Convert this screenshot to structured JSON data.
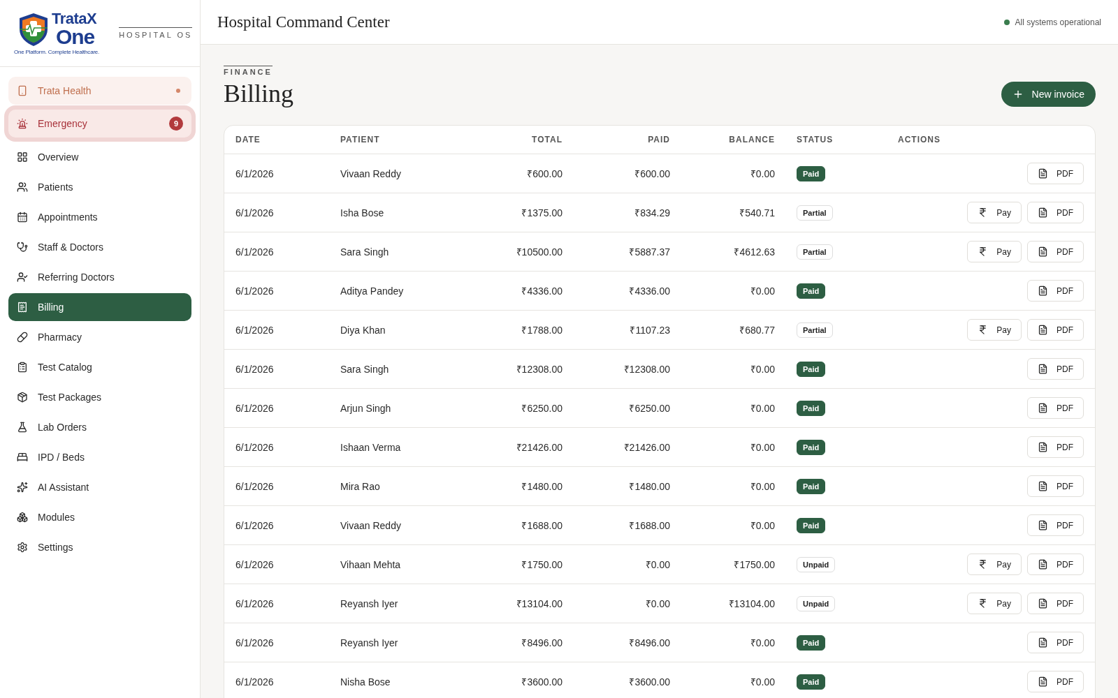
{
  "brand": {
    "name_top": "TrataX",
    "name_bottom": "One",
    "tagline": "One Platform. Complete Healthcare.",
    "product": "HOSPITAL OS"
  },
  "sidebar": {
    "items": [
      {
        "label": "Trata Health",
        "kind": "brand",
        "selected": false,
        "dot": true
      },
      {
        "label": "Emergency",
        "kind": "alert",
        "selected": false,
        "badge": "9"
      },
      {
        "label": "Overview",
        "kind": "normal",
        "selected": false
      },
      {
        "label": "Patients",
        "kind": "normal",
        "selected": false
      },
      {
        "label": "Appointments",
        "kind": "normal",
        "selected": false
      },
      {
        "label": "Staff & Doctors",
        "kind": "normal",
        "selected": false
      },
      {
        "label": "Referring Doctors",
        "kind": "normal",
        "selected": false
      },
      {
        "label": "Billing",
        "kind": "normal",
        "selected": true
      },
      {
        "label": "Pharmacy",
        "kind": "normal",
        "selected": false
      },
      {
        "label": "Test Catalog",
        "kind": "normal",
        "selected": false
      },
      {
        "label": "Test Packages",
        "kind": "normal",
        "selected": false
      },
      {
        "label": "Lab Orders",
        "kind": "normal",
        "selected": false
      },
      {
        "label": "IPD / Beds",
        "kind": "normal",
        "selected": false
      },
      {
        "label": "AI Assistant",
        "kind": "normal",
        "selected": false
      },
      {
        "label": "Modules",
        "kind": "normal",
        "selected": false
      },
      {
        "label": "Settings",
        "kind": "normal",
        "selected": false
      }
    ]
  },
  "header": {
    "title": "Hospital Command Center",
    "status": "All systems operational"
  },
  "page": {
    "eyebrow": "FINANCE",
    "title": "Billing",
    "new_button": "New invoice"
  },
  "table": {
    "columns": [
      "DATE",
      "PATIENT",
      "TOTAL",
      "PAID",
      "BALANCE",
      "STATUS",
      "ACTIONS"
    ],
    "rows": [
      {
        "date": "6/1/2026",
        "patient": "Vivaan Reddy",
        "total": "₹600.00",
        "paid": "₹600.00",
        "balance": "₹0.00",
        "status": {
          "label": "Paid",
          "kind": "paid"
        },
        "actions": [
          {
            "kind": "pdf",
            "label": "PDF"
          }
        ]
      },
      {
        "date": "6/1/2026",
        "patient": "Isha Bose",
        "total": "₹1375.00",
        "paid": "₹834.29",
        "balance": "₹540.71",
        "status": {
          "label": "Partial",
          "kind": "partial"
        },
        "actions": [
          {
            "kind": "pay",
            "label": "Pay"
          },
          {
            "kind": "pdf",
            "label": "PDF"
          }
        ]
      },
      {
        "date": "6/1/2026",
        "patient": "Sara Singh",
        "total": "₹10500.00",
        "paid": "₹5887.37",
        "balance": "₹4612.63",
        "status": {
          "label": "Partial",
          "kind": "partial"
        },
        "actions": [
          {
            "kind": "pay",
            "label": "Pay"
          },
          {
            "kind": "pdf",
            "label": "PDF"
          }
        ]
      },
      {
        "date": "6/1/2026",
        "patient": "Aditya Pandey",
        "total": "₹4336.00",
        "paid": "₹4336.00",
        "balance": "₹0.00",
        "status": {
          "label": "Paid",
          "kind": "paid"
        },
        "actions": [
          {
            "kind": "pdf",
            "label": "PDF"
          }
        ]
      },
      {
        "date": "6/1/2026",
        "patient": "Diya Khan",
        "total": "₹1788.00",
        "paid": "₹1107.23",
        "balance": "₹680.77",
        "status": {
          "label": "Partial",
          "kind": "partial"
        },
        "actions": [
          {
            "kind": "pay",
            "label": "Pay"
          },
          {
            "kind": "pdf",
            "label": "PDF"
          }
        ]
      },
      {
        "date": "6/1/2026",
        "patient": "Sara Singh",
        "total": "₹12308.00",
        "paid": "₹12308.00",
        "balance": "₹0.00",
        "status": {
          "label": "Paid",
          "kind": "paid"
        },
        "actions": [
          {
            "kind": "pdf",
            "label": "PDF"
          }
        ]
      },
      {
        "date": "6/1/2026",
        "patient": "Arjun Singh",
        "total": "₹6250.00",
        "paid": "₹6250.00",
        "balance": "₹0.00",
        "status": {
          "label": "Paid",
          "kind": "paid"
        },
        "actions": [
          {
            "kind": "pdf",
            "label": "PDF"
          }
        ]
      },
      {
        "date": "6/1/2026",
        "patient": "Ishaan Verma",
        "total": "₹21426.00",
        "paid": "₹21426.00",
        "balance": "₹0.00",
        "status": {
          "label": "Paid",
          "kind": "paid"
        },
        "actions": [
          {
            "kind": "pdf",
            "label": "PDF"
          }
        ]
      },
      {
        "date": "6/1/2026",
        "patient": "Mira Rao",
        "total": "₹1480.00",
        "paid": "₹1480.00",
        "balance": "₹0.00",
        "status": {
          "label": "Paid",
          "kind": "paid"
        },
        "actions": [
          {
            "kind": "pdf",
            "label": "PDF"
          }
        ]
      },
      {
        "date": "6/1/2026",
        "patient": "Vivaan Reddy",
        "total": "₹1688.00",
        "paid": "₹1688.00",
        "balance": "₹0.00",
        "status": {
          "label": "Paid",
          "kind": "paid"
        },
        "actions": [
          {
            "kind": "pdf",
            "label": "PDF"
          }
        ]
      },
      {
        "date": "6/1/2026",
        "patient": "Vihaan Mehta",
        "total": "₹1750.00",
        "paid": "₹0.00",
        "balance": "₹1750.00",
        "status": {
          "label": "Unpaid",
          "kind": "unpaid"
        },
        "actions": [
          {
            "kind": "pay",
            "label": "Pay"
          },
          {
            "kind": "pdf",
            "label": "PDF"
          }
        ]
      },
      {
        "date": "6/1/2026",
        "patient": "Reyansh Iyer",
        "total": "₹13104.00",
        "paid": "₹0.00",
        "balance": "₹13104.00",
        "status": {
          "label": "Unpaid",
          "kind": "unpaid"
        },
        "actions": [
          {
            "kind": "pay",
            "label": "Pay"
          },
          {
            "kind": "pdf",
            "label": "PDF"
          }
        ]
      },
      {
        "date": "6/1/2026",
        "patient": "Reyansh Iyer",
        "total": "₹8496.00",
        "paid": "₹8496.00",
        "balance": "₹0.00",
        "status": {
          "label": "Paid",
          "kind": "paid"
        },
        "actions": [
          {
            "kind": "pdf",
            "label": "PDF"
          }
        ]
      },
      {
        "date": "6/1/2026",
        "patient": "Nisha Bose",
        "total": "₹3600.00",
        "paid": "₹3600.00",
        "balance": "₹0.00",
        "status": {
          "label": "Paid",
          "kind": "paid"
        },
        "actions": [
          {
            "kind": "pdf",
            "label": "PDF"
          }
        ]
      }
    ]
  }
}
